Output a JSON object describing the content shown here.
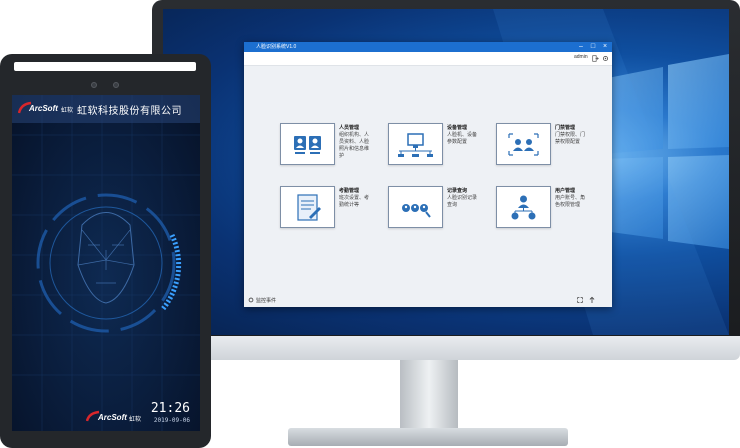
{
  "app": {
    "title": "人脸识别系统V1.0",
    "username": "admin",
    "status_label": "监控事件"
  },
  "tiles": [
    {
      "title": "人员管理",
      "desc": "组织机构、人员资料、人脸照片和信息维护",
      "icon": "people-cards-icon"
    },
    {
      "title": "设备管理",
      "desc": "人脸机、设备参数配置",
      "icon": "device-network-icon"
    },
    {
      "title": "门禁管理",
      "desc": "门禁权限、门禁权限配置",
      "icon": "access-control-icon"
    },
    {
      "title": "考勤管理",
      "desc": "班次设置、考勤统计等",
      "icon": "attendance-document-icon"
    },
    {
      "title": "记录查询",
      "desc": "人脸识别记录查询",
      "icon": "record-search-icon"
    },
    {
      "title": "用户管理",
      "desc": "用户账号、角色权限管理",
      "icon": "user-hierarchy-icon"
    }
  ],
  "tablet": {
    "brand": "ArcSoft",
    "brand_cn": "虹软",
    "company": "虹软科技股份有限公司",
    "time": "21:26",
    "date": "2019-09-06"
  },
  "colors": {
    "title_bar": "#1c6fd0",
    "icon_blue": "#2c6fb6",
    "brand_red": "#d8262b"
  }
}
